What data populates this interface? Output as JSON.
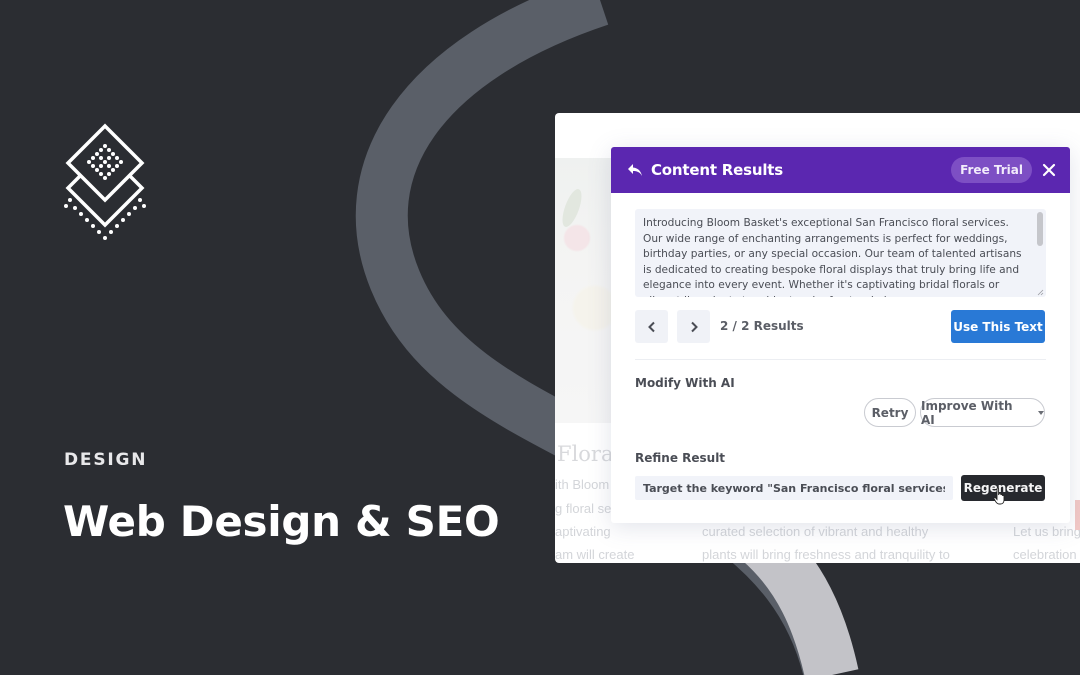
{
  "hero": {
    "category": "DESIGN",
    "title": "Web Design & SEO"
  },
  "background_page": {
    "heading_fragment": "Florals",
    "column1_lines": [
      "ith Bloom",
      "g floral ser",
      "aptivating",
      "am will create"
    ],
    "column2_lines": [
      "curated selection of vibrant and healthy",
      "plants will bring freshness and tranquility to"
    ],
    "column3_lines": [
      "Let us bring",
      "celebration"
    ]
  },
  "modal": {
    "title": "Content Results",
    "free_trial_label": "Free Trial",
    "content_text": "Introducing Bloom Basket's exceptional San Francisco floral services. Our wide range of enchanting arrangements is perfect for weddings, birthday parties, or any special occasion. Our team of talented artisans is dedicated to creating bespoke floral displays that truly bring life and elegance into every event. Whether it's captivating bridal florals or vibrant live plants to add a touch of natural elegance",
    "results_counter": "2 / 2 Results",
    "use_text_label": "Use This Text",
    "modify_label": "Modify With AI",
    "retry_label": "Retry",
    "improve_label": "Improve With AI",
    "refine_label": "Refine Result",
    "refine_value": "Target the keyword \"San Francisco floral services\"",
    "regenerate_label": "Regenerate"
  },
  "colors": {
    "background": "#2b2d32",
    "header_purple": "#5b27b0",
    "primary_blue": "#2979d6",
    "dark_button": "#27292e"
  }
}
